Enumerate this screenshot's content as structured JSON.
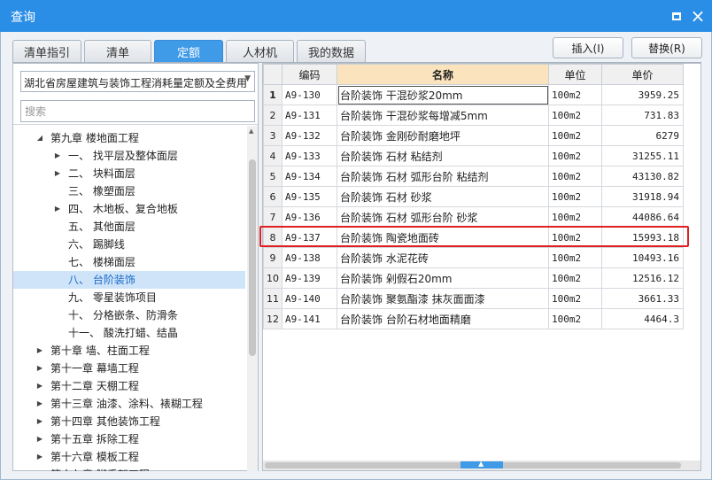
{
  "window": {
    "title": "查询",
    "minimize_glyph": "◘",
    "close_glyph": "×"
  },
  "tabs": [
    {
      "label": "清单指引",
      "active": false
    },
    {
      "label": "清单",
      "active": false
    },
    {
      "label": "定额",
      "active": true
    },
    {
      "label": "人材机",
      "active": false
    },
    {
      "label": "我的数据",
      "active": false
    }
  ],
  "actions": {
    "insert_label": "插入(I)",
    "replace_label": "替换(R)"
  },
  "left_panel": {
    "library_select": "湖北省房屋建筑与装饰工程消耗量定额及全费用",
    "search_placeholder": "搜索",
    "tree": [
      {
        "label": "第九章 楼地面工程",
        "expander": "◢",
        "depth": 1,
        "selected": false
      },
      {
        "label": "一、 找平层及整体面层",
        "expander": "▶",
        "depth": 2,
        "selected": false
      },
      {
        "label": "二、 块料面层",
        "expander": "▶",
        "depth": 2,
        "selected": false
      },
      {
        "label": "三、 橡塑面层",
        "expander": "",
        "depth": 2,
        "selected": false
      },
      {
        "label": "四、 木地板、复合地板",
        "expander": "▶",
        "depth": 2,
        "selected": false
      },
      {
        "label": "五、 其他面层",
        "expander": "",
        "depth": 2,
        "selected": false
      },
      {
        "label": "六、 踢脚线",
        "expander": "",
        "depth": 2,
        "selected": false
      },
      {
        "label": "七、 楼梯面层",
        "expander": "",
        "depth": 2,
        "selected": false
      },
      {
        "label": "八、 台阶装饰",
        "expander": "",
        "depth": 2,
        "selected": true
      },
      {
        "label": "九、 零星装饰项目",
        "expander": "",
        "depth": 2,
        "selected": false
      },
      {
        "label": "十、 分格嵌条、防滑条",
        "expander": "",
        "depth": 2,
        "selected": false
      },
      {
        "label": "十一、 酸洗打蜡、结晶",
        "expander": "",
        "depth": 2,
        "selected": false
      },
      {
        "label": "第十章 墙、柱面工程",
        "expander": "▶",
        "depth": 1,
        "selected": false
      },
      {
        "label": "第十一章 幕墙工程",
        "expander": "▶",
        "depth": 1,
        "selected": false
      },
      {
        "label": "第十二章 天棚工程",
        "expander": "▶",
        "depth": 1,
        "selected": false
      },
      {
        "label": "第十三章 油漆、涂料、裱糊工程",
        "expander": "▶",
        "depth": 1,
        "selected": false
      },
      {
        "label": "第十四章 其他装饰工程",
        "expander": "▶",
        "depth": 1,
        "selected": false
      },
      {
        "label": "第十五章 拆除工程",
        "expander": "▶",
        "depth": 1,
        "selected": false
      },
      {
        "label": "第十六章 模板工程",
        "expander": "▶",
        "depth": 1,
        "selected": false
      },
      {
        "label": "第十七章 脚手架工程",
        "expander": "▶",
        "depth": 1,
        "selected": false
      }
    ]
  },
  "grid": {
    "headers": [
      "",
      "编码",
      "名称",
      "单位",
      "单价"
    ],
    "rows": [
      {
        "n": "1",
        "code": "A9-130",
        "name": "台阶装饰 干混砂浆20mm",
        "unit": "100m2",
        "price": "3959.25"
      },
      {
        "n": "2",
        "code": "A9-131",
        "name": "台阶装饰 干混砂浆每增减5mm",
        "unit": "100m2",
        "price": "731.83"
      },
      {
        "n": "3",
        "code": "A9-132",
        "name": "台阶装饰 金刚砂耐磨地坪",
        "unit": "100m2",
        "price": "6279"
      },
      {
        "n": "4",
        "code": "A9-133",
        "name": "台阶装饰 石材 粘结剂",
        "unit": "100m2",
        "price": "31255.11"
      },
      {
        "n": "5",
        "code": "A9-134",
        "name": "台阶装饰 石材 弧形台阶 粘结剂",
        "unit": "100m2",
        "price": "43130.82"
      },
      {
        "n": "6",
        "code": "A9-135",
        "name": "台阶装饰 石材 砂浆",
        "unit": "100m2",
        "price": "31918.94"
      },
      {
        "n": "7",
        "code": "A9-136",
        "name": "台阶装饰 石材 弧形台阶 砂浆",
        "unit": "100m2",
        "price": "44086.64"
      },
      {
        "n": "8",
        "code": "A9-137",
        "name": "台阶装饰 陶瓷地面砖",
        "unit": "100m2",
        "price": "15993.18"
      },
      {
        "n": "9",
        "code": "A9-138",
        "name": "台阶装饰 水泥花砖",
        "unit": "100m2",
        "price": "10493.16"
      },
      {
        "n": "10",
        "code": "A9-139",
        "name": "台阶装饰 剁假石20mm",
        "unit": "100m2",
        "price": "12516.12"
      },
      {
        "n": "11",
        "code": "A9-140",
        "name": "台阶装饰 聚氨酯漆 抹灰面面漆",
        "unit": "100m2",
        "price": "3661.33"
      },
      {
        "n": "12",
        "code": "A9-141",
        "name": "台阶装饰 台阶石材地面精磨",
        "unit": "100m2",
        "price": "4464.3"
      }
    ],
    "current_row": 1,
    "highlighted_row": 8
  },
  "colors": {
    "titlebar": "#2b8ee6",
    "active_tab": "#3f9ae8",
    "highlight_border": "#e02020",
    "name_header": "#fbe4bd",
    "tree_selected": "#cfe4f9"
  },
  "icons": {
    "minimize": "minimize-icon",
    "close": "close-icon",
    "dropdown": "chevron-down-icon",
    "tree_collapsed": "caret-right-icon",
    "tree_expanded": "caret-down-icon"
  }
}
